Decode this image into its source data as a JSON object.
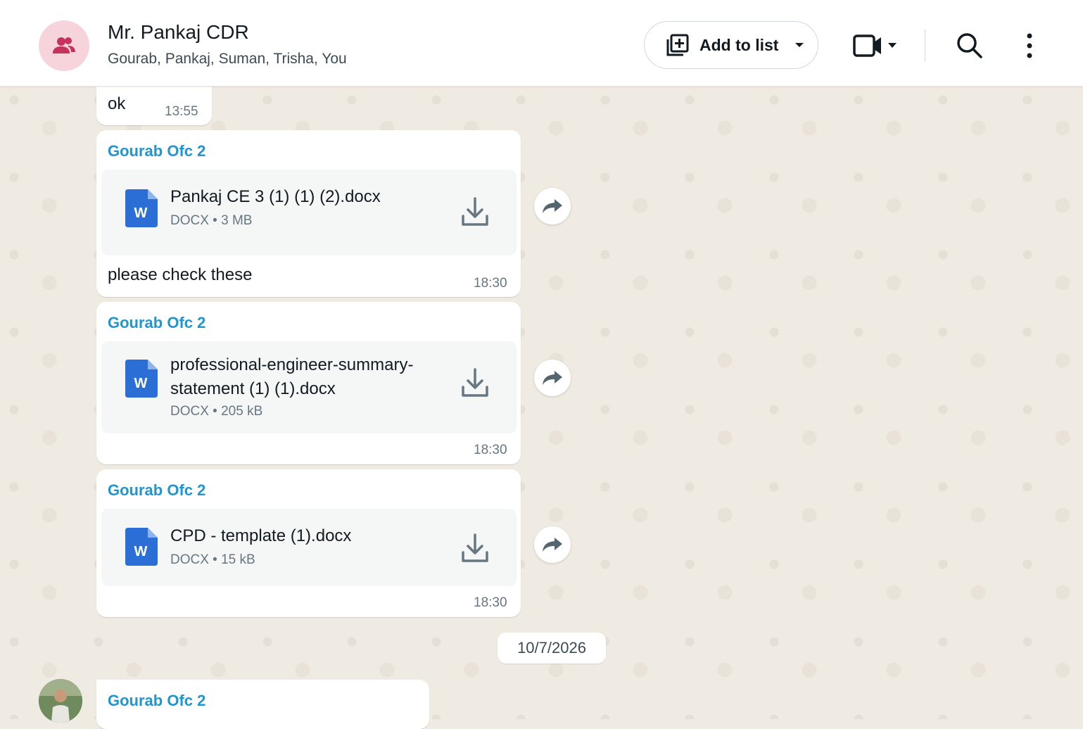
{
  "header": {
    "title": "Mr. Pankaj CDR",
    "participants": "Gourab, Pankaj, Suman, Trisha, You",
    "add_to_list_label": "Add to list"
  },
  "messages": [
    {
      "text": "ok",
      "time": "13:55"
    },
    {
      "sender": "Gourab Ofc 2",
      "file_name": "Pankaj CE 3 (1) (1) (2).docx",
      "file_meta": "DOCX • 3 MB",
      "caption": "please check these",
      "time": "18:30"
    },
    {
      "sender": "Gourab Ofc 2",
      "file_name": "professional-engineer-summary-statement (1) (1).docx",
      "file_meta": "DOCX • 205 kB",
      "time": "18:30"
    },
    {
      "sender": "Gourab Ofc 2",
      "file_name": "CPD - template (1).docx",
      "file_meta": "DOCX • 15 kB",
      "time": "18:30"
    },
    {
      "sender": "Gourab Ofc 2"
    }
  ],
  "date_separator": "10/7/2026",
  "icons": {
    "group": "group-icon",
    "add_list": "add-to-list-icon",
    "video": "video-call-icon",
    "search": "search-icon",
    "menu": "more-options-icon",
    "document": "word-document-icon",
    "download": "download-icon",
    "forward": "forward-icon"
  },
  "colors": {
    "sender_name": "#1f96d1",
    "group_avatar_bg": "#f7d4dc",
    "group_avatar_icon": "#c5325a",
    "word_icon": "#2b6fd6",
    "chat_background": "#efeae2"
  }
}
